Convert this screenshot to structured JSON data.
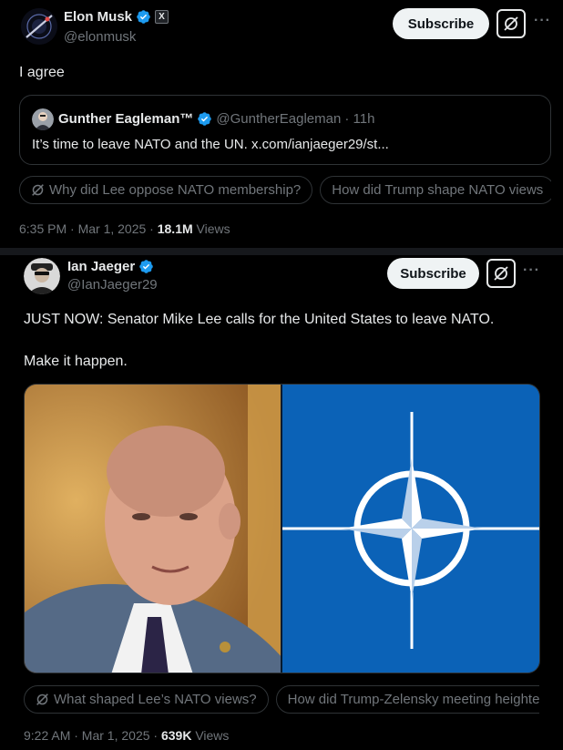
{
  "tweet1": {
    "author_name": "Elon Musk",
    "author_handle": "@elonmusk",
    "subscribe_label": "Subscribe",
    "text": "I agree",
    "quote": {
      "author_name": "Gunther Eagleman™",
      "author_handle": "@GuntherEagleman",
      "time": "· 11h",
      "text": "It’s time to leave NATO and the UN. x.com/ianjaeger29/st..."
    },
    "pills": [
      "Why did Lee oppose NATO membership?",
      "How did Trump shape NATO views"
    ],
    "timestamp": "6:35 PM · Mar 1, 2025 · ",
    "views_count": "18.1M",
    "views_label": " Views"
  },
  "tweet2": {
    "author_name": "Ian Jaeger",
    "author_handle": "@IanJaeger29",
    "subscribe_label": "Subscribe",
    "text_line1": "JUST NOW: Senator Mike Lee calls for the United States to leave NATO.",
    "text_line2": "Make it happen.",
    "pills": [
      "What shaped Lee’s NATO views?",
      "How did Trump-Zelensky meeting heighten tensions"
    ],
    "timestamp": "9:22 AM · Mar 1, 2025 · ",
    "views_count": "639K",
    "views_label": " Views"
  },
  "colors": {
    "background": "#000000",
    "text_primary": "#e7e9ea",
    "text_secondary": "#71767b",
    "verified_blue": "#1d9bf0",
    "border": "#2f3336",
    "nato_blue": "#0b62b7"
  },
  "icons": {
    "verified": "verified-badge-icon",
    "affiliate": "x-affiliate-icon",
    "grok": "grok-icon",
    "more": "more-icon"
  }
}
